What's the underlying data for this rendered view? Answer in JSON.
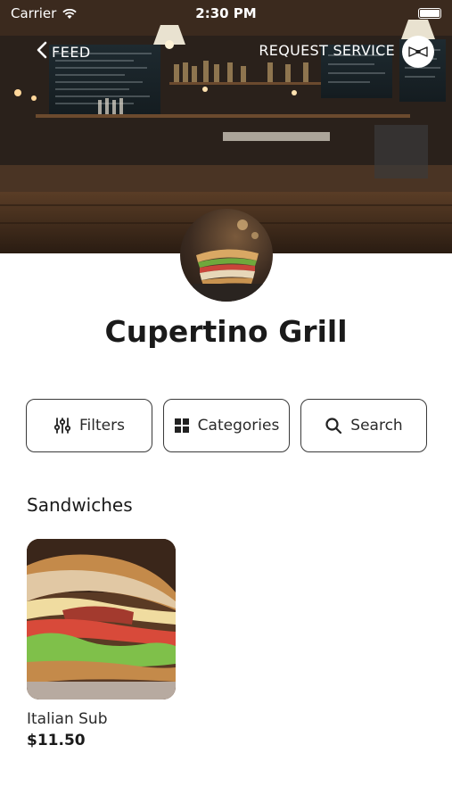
{
  "status_bar": {
    "carrier": "Carrier",
    "time": "2:30 PM"
  },
  "nav": {
    "back_label": "FEED",
    "request_service_label": "REQUEST SERVICE"
  },
  "restaurant": {
    "name": "Cupertino Grill"
  },
  "actions": {
    "filters_label": "Filters",
    "categories_label": "Categories",
    "search_label": "Search"
  },
  "menu": {
    "section_title": "Sandwiches",
    "items": [
      {
        "name": "Italian Sub",
        "price": "$11.50"
      }
    ]
  },
  "icons": {
    "back": "chevron-left-icon",
    "waiter": "bowtie-icon",
    "filters": "sliders-icon",
    "categories": "grid-icon",
    "search": "search-icon"
  }
}
